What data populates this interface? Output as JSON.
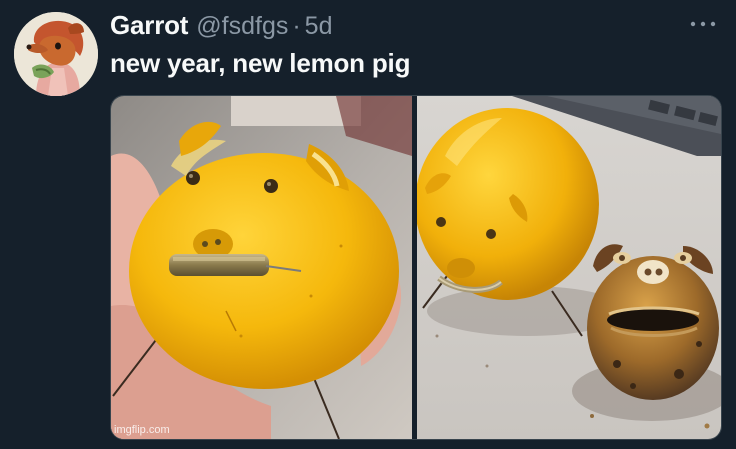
{
  "author": {
    "display_name": "Garrot",
    "handle": "@fsdfgs",
    "separator": "·",
    "time": "5d"
  },
  "tweet": {
    "text": "new year, new lemon pig"
  },
  "menu": {
    "icon": "more-horizontal-icon"
  },
  "media": {
    "photos": [
      {
        "subject": "lemon-pig-with-coin-photo"
      },
      {
        "subject": "new-and-old-lemon-pig-photo"
      }
    ]
  },
  "watermark": {
    "text": "imgflip.com"
  },
  "colors": {
    "background": "#15202b",
    "primary_text": "#f7f9f9",
    "secondary_text": "#8b98a5",
    "border": "#38444d"
  }
}
